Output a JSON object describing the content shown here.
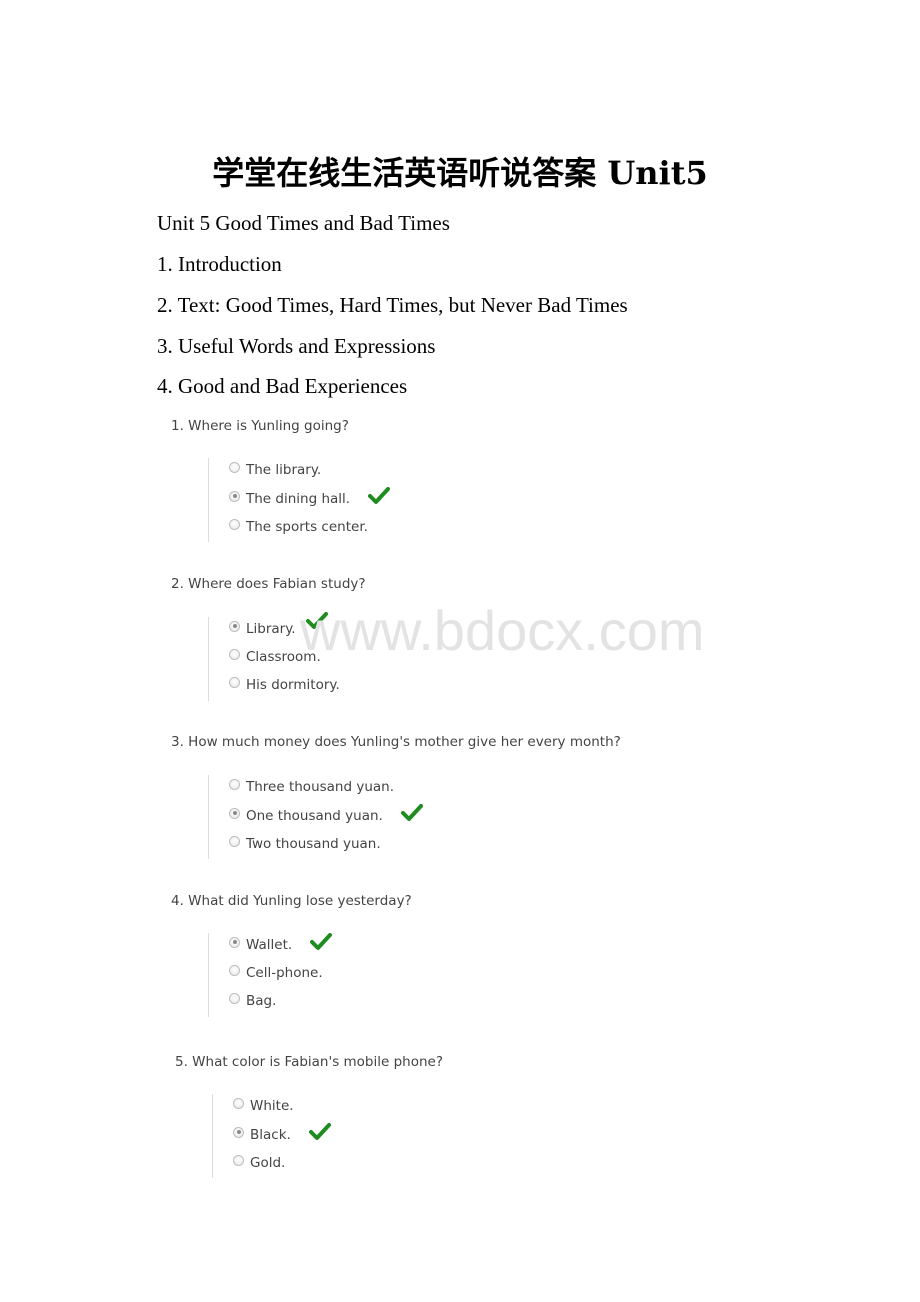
{
  "document": {
    "title": "学堂在线生活英语听说答案 Unit5",
    "paragraphs": [
      "Unit 5 Good Times and Bad Times",
      "1. Introduction",
      "2. Text: Good Times, Hard Times, but Never Bad Times",
      "3. Useful Words and Expressions",
      "4. Good and Bad Experiences"
    ],
    "watermark": "www.bdocx.com",
    "check_color": "#1e8c1e"
  },
  "questions": [
    {
      "text": "1. Where is Yunling going?",
      "options": [
        "The library.",
        "The dining hall.",
        "The sports center."
      ],
      "selected": 1,
      "correct": 1
    },
    {
      "text": "2. Where does Fabian study?",
      "options": [
        "Library.",
        "Classroom.",
        "His dormitory."
      ],
      "selected": 0,
      "correct": 0
    },
    {
      "text": "3. How much money does Yunling's mother give her every month?",
      "options": [
        "Three thousand yuan.",
        "One thousand yuan.",
        "Two thousand yuan."
      ],
      "selected": 1,
      "correct": 1
    },
    {
      "text": "4. What did Yunling lose yesterday?",
      "options": [
        "Wallet.",
        "Cell-phone.",
        "Bag."
      ],
      "selected": 0,
      "correct": 0
    },
    {
      "text": "5. What color is Fabian's mobile phone?",
      "options": [
        "White.",
        "Black.",
        "Gold."
      ],
      "selected": 1,
      "correct": 1
    }
  ]
}
